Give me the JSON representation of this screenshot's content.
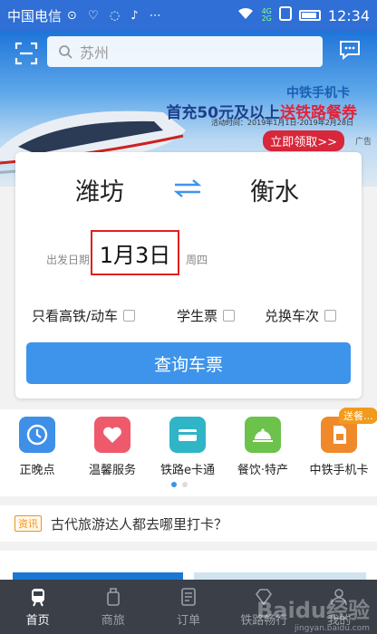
{
  "status_bar": {
    "carrier": "中国电信",
    "net_4g": "4G",
    "net_2g": "2G",
    "time": "12:34"
  },
  "banner": {
    "search_placeholder": "苏州",
    "ad_title": "中铁手机卡",
    "ad_line_prefix": "首充50元及以上",
    "ad_line_highlight": "送铁路餐券",
    "ad_date": "活动时间：2019年1月1日-2019年2月28日",
    "cta": "立即领取>>",
    "ad_tag": "广告"
  },
  "booking": {
    "from_station": "潍坊",
    "to_station": "衡水",
    "date_label": "出发日期",
    "date_value": "1月3日",
    "weekday": "周四",
    "options": [
      "只看高铁/动车",
      "学生票",
      "兑换车次"
    ],
    "query_button": "查询车票"
  },
  "quick_menu": {
    "items": [
      {
        "label": "正晚点",
        "icon": "clock-icon",
        "color": "#3e8fe8"
      },
      {
        "label": "温馨服务",
        "icon": "heart-icon",
        "color": "#ee5a6c"
      },
      {
        "label": "铁路e卡通",
        "icon": "card-icon",
        "color": "#2fb5c6"
      },
      {
        "label": "餐饮·特产",
        "icon": "food-cloche-icon",
        "color": "#6cc24a"
      },
      {
        "label": "中铁手机卡",
        "icon": "sim-card-icon",
        "color": "#f0892a"
      }
    ],
    "promo_tag": "送餐..."
  },
  "news": {
    "tag": "资讯",
    "title": "古代旅游达人都去哪里打卡？"
  },
  "tab_bar": {
    "tabs": [
      {
        "label": "首页",
        "icon": "train-icon",
        "active": true
      },
      {
        "label": "商旅",
        "icon": "luggage-icon",
        "active": false
      },
      {
        "label": "订单",
        "icon": "order-icon",
        "active": false
      },
      {
        "label": "铁路畅行",
        "icon": "diamond-icon",
        "active": false
      },
      {
        "label": "我的",
        "icon": "user-icon",
        "active": false
      }
    ]
  },
  "watermark": {
    "brand": "Baidu经验",
    "url": "jingyan.baidu.com"
  }
}
